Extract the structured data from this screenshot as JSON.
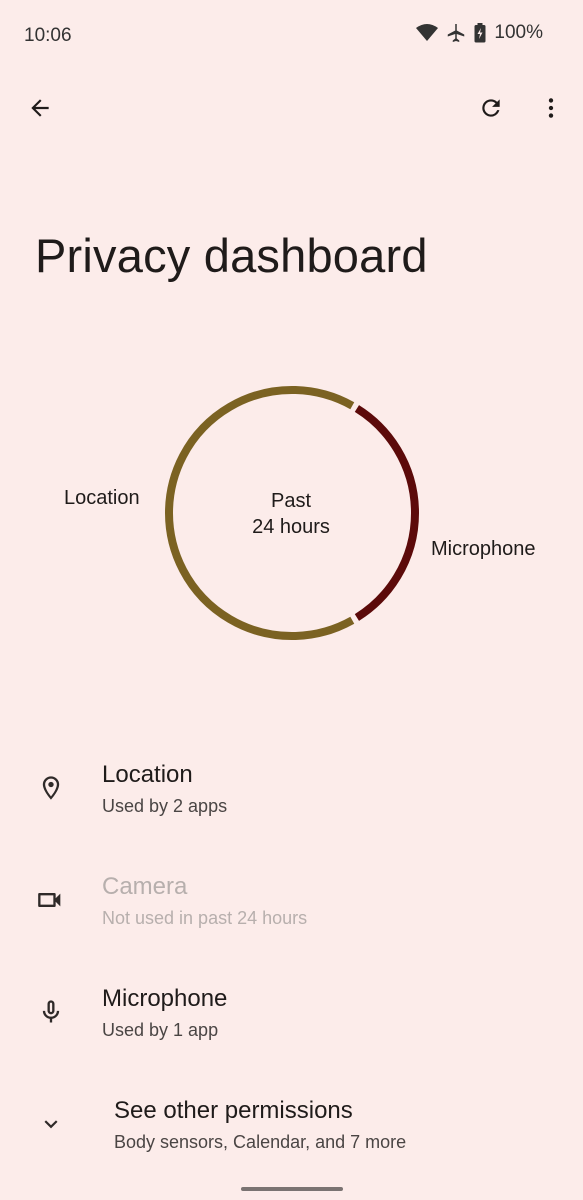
{
  "status_bar": {
    "time": "10:06",
    "battery": "100%",
    "icons": [
      "wifi-icon",
      "airplane-mode-icon",
      "battery-icon"
    ]
  },
  "top_bar": {
    "icons": [
      "back-arrow-icon",
      "refresh-icon",
      "more-vert-icon"
    ]
  },
  "page": {
    "title": "Privacy dashboard"
  },
  "usage_ring": {
    "center_line1": "Past",
    "center_line2": "24 hours",
    "segments": [
      {
        "label": "Location",
        "fraction": 0.67,
        "color": "#7b6222"
      },
      {
        "label": "Microphone",
        "fraction": 0.33,
        "color": "#5c0a0a"
      }
    ]
  },
  "permissions": [
    {
      "icon": "location-pin-icon",
      "title": "Location",
      "subtitle": "Used by 2 apps",
      "enabled": true
    },
    {
      "icon": "camera-icon",
      "title": "Camera",
      "subtitle": "Not used in past 24 hours",
      "enabled": false
    },
    {
      "icon": "microphone-icon",
      "title": "Microphone",
      "subtitle": "Used by 1 app",
      "enabled": true
    }
  ],
  "other_permissions": {
    "icon": "chevron-down-icon",
    "title": "See other permissions",
    "subtitle": "Body sensors, Calendar, and 7 more"
  },
  "colors": {
    "background": "#fcecea",
    "location": "#7b6222",
    "microphone": "#5c0a0a"
  }
}
